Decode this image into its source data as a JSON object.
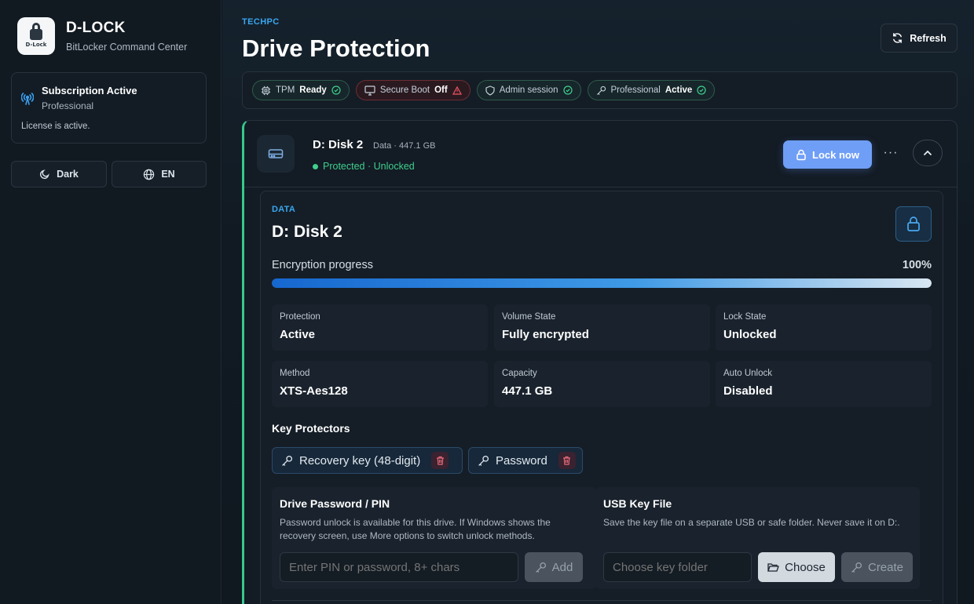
{
  "sidebar": {
    "brand_title": "D-LOCK",
    "brand_subtitle": "BitLocker Command Center",
    "logo_text": "D-Lock",
    "subscription": {
      "title": "Subscription Active",
      "tier": "Professional",
      "license": "License is active."
    },
    "theme_button": "Dark",
    "language_button": "EN"
  },
  "header": {
    "eyebrow": "TECHPC",
    "title": "Drive Protection",
    "refresh_label": "Refresh"
  },
  "status_pills": [
    {
      "label": "TPM",
      "value": "Ready",
      "state": "ok"
    },
    {
      "label": "Secure Boot",
      "value": "Off",
      "state": "warn"
    },
    {
      "label": "Admin session",
      "value": "",
      "state": "ok"
    },
    {
      "label": "Professional",
      "value": "Active",
      "state": "ok"
    }
  ],
  "drive": {
    "name": "D: Disk 2",
    "meta": "Data · 447.1 GB",
    "status": "Protected · Unlocked",
    "lock_button": "Lock now",
    "more_label": "···",
    "detail": {
      "eyebrow": "DATA",
      "title": "D: Disk 2",
      "progress_label": "Encryption progress",
      "progress_value": "100%",
      "progress_fraction": 1.0,
      "stats": [
        {
          "key": "Protection",
          "value": "Active"
        },
        {
          "key": "Volume State",
          "value": "Fully encrypted"
        },
        {
          "key": "Lock State",
          "value": "Unlocked"
        },
        {
          "key": "Method",
          "value": "XTS-Aes128"
        },
        {
          "key": "Capacity",
          "value": "447.1 GB"
        },
        {
          "key": "Auto Unlock",
          "value": "Disabled"
        }
      ],
      "key_protectors_title": "Key Protectors",
      "key_protectors": [
        "Recovery key (48-digit)",
        "Password"
      ],
      "password_panel": {
        "title": "Drive Password / PIN",
        "description": "Password unlock is available for this drive. If Windows shows the recovery screen, use More options to switch unlock methods.",
        "placeholder": "Enter PIN or password, 8+ chars",
        "button": "Add"
      },
      "usb_panel": {
        "title": "USB Key File",
        "description": "Save the key file on a separate USB or safe folder. Never save it on D:.",
        "placeholder": "Choose key folder",
        "choose_button": "Choose",
        "create_button": "Create"
      }
    }
  },
  "colors": {
    "accent_blue": "#3aa6ee",
    "success_green": "#3fcf8e",
    "danger_red": "#f25563",
    "lock_button": "#6f9ef6"
  }
}
